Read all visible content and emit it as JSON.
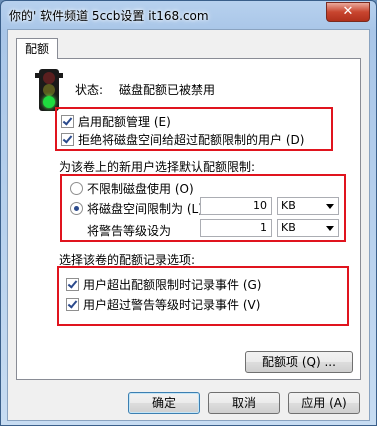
{
  "window": {
    "title": "你的' 软件频道 5ccb设置 it168.com",
    "close_label": "✕"
  },
  "tab": {
    "label": "配额"
  },
  "status": {
    "label": "状态:",
    "value": "磁盘配额已被禁用"
  },
  "checkboxes": {
    "enable_quota": {
      "label": "启用配额管理 (E)",
      "checked": true
    },
    "deny_space": {
      "label": "拒绝将磁盘空间给超过配额限制的用户 (D)",
      "checked": true
    }
  },
  "default_limit": {
    "heading": "为该卷上的新用户选择默认配额限制:",
    "no_limit": {
      "label": "不限制磁盘使用 (O)",
      "selected": false
    },
    "limit": {
      "label": "将磁盘空间限制为 (L)",
      "selected": true,
      "value": "10",
      "unit": "KB"
    },
    "warning": {
      "label": "将警告等级设为",
      "value": "1",
      "unit": "KB"
    }
  },
  "logging": {
    "heading": "选择该卷的配额记录选项:",
    "log_limit": {
      "label": "用户超出配额限制时记录事件 (G)",
      "checked": true
    },
    "log_warning": {
      "label": "用户超过警告等级时记录事件 (V)",
      "checked": true
    }
  },
  "buttons": {
    "entries": "配额项 (Q) ...",
    "ok": "确定",
    "cancel": "取消",
    "apply": "应用 (A)"
  },
  "colors": {
    "highlight": "#e0141e",
    "title_bar": "#a9c6e8"
  }
}
